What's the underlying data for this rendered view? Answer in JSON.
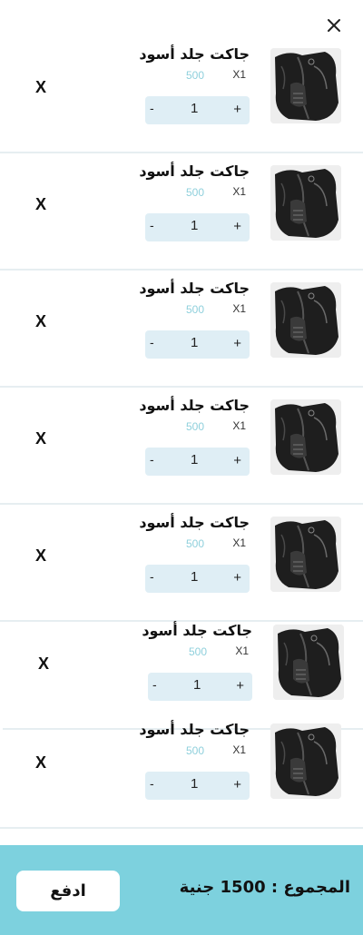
{
  "close_label": "",
  "items": [
    {
      "name": "جاكت جلد أسود",
      "qty_label": "X1",
      "price": "500",
      "quantity": "1",
      "plus": "+",
      "minus": "-",
      "remove": "X"
    },
    {
      "name": "جاكت جلد أسود",
      "qty_label": "X1",
      "price": "500",
      "quantity": "1",
      "plus": "+",
      "minus": "-",
      "remove": "X"
    },
    {
      "name": "جاكت جلد أسود",
      "qty_label": "X1",
      "price": "500",
      "quantity": "1",
      "plus": "+",
      "minus": "-",
      "remove": "X"
    },
    {
      "name": "جاكت جلد أسود",
      "qty_label": "X1",
      "price": "500",
      "quantity": "1",
      "plus": "+",
      "minus": "-",
      "remove": "X"
    },
    {
      "name": "جاكت جلد أسود",
      "qty_label": "X1",
      "price": "500",
      "quantity": "1",
      "plus": "+",
      "minus": "-",
      "remove": "X"
    },
    {
      "name": "جاكت جلد أسود",
      "qty_label": "X1",
      "price": "500",
      "quantity": "1",
      "plus": "+",
      "minus": "-",
      "remove": "X"
    },
    {
      "name": "جاكت جلد أسود",
      "qty_label": "X1",
      "price": "500",
      "quantity": "1",
      "plus": "+",
      "minus": "-",
      "remove": "X"
    }
  ],
  "footer": {
    "total_text": "المجموع : 1500 جنية",
    "pay_label": "ادفع"
  },
  "colors": {
    "accent": "#7dd1de",
    "price": "#8fd0dc",
    "stepper_bg": "#dfeef5"
  },
  "icons": {
    "close": "close-icon",
    "thumbnail": "jacket-image"
  }
}
